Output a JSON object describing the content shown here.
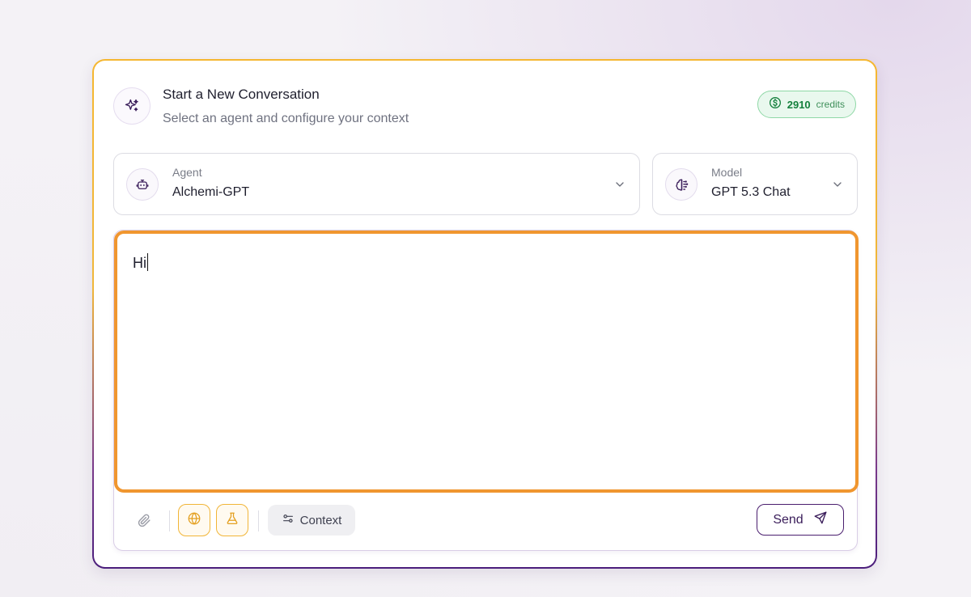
{
  "header": {
    "title": "Start a New Conversation",
    "subtitle": "Select an agent and configure your context",
    "icon": "sparkles-icon"
  },
  "credits": {
    "amount": "2910",
    "label": "credits",
    "icon": "dollar-circle-icon",
    "color": "#15803d"
  },
  "agent_selector": {
    "label": "Agent",
    "value": "Alchemi-GPT",
    "icon": "robot-icon"
  },
  "model_selector": {
    "label": "Model",
    "value": "GPT 5.3 Chat",
    "icon": "brain-icon"
  },
  "composer": {
    "text": "Hi"
  },
  "toolbar": {
    "attach_icon": "paperclip-icon",
    "web_icon": "globe-icon",
    "lab_icon": "flask-icon",
    "context_label": "Context",
    "send_label": "Send"
  },
  "colors": {
    "accent_orange": "#f0962f",
    "accent_gold": "#f1b537",
    "accent_purple": "#4a1e6e"
  }
}
